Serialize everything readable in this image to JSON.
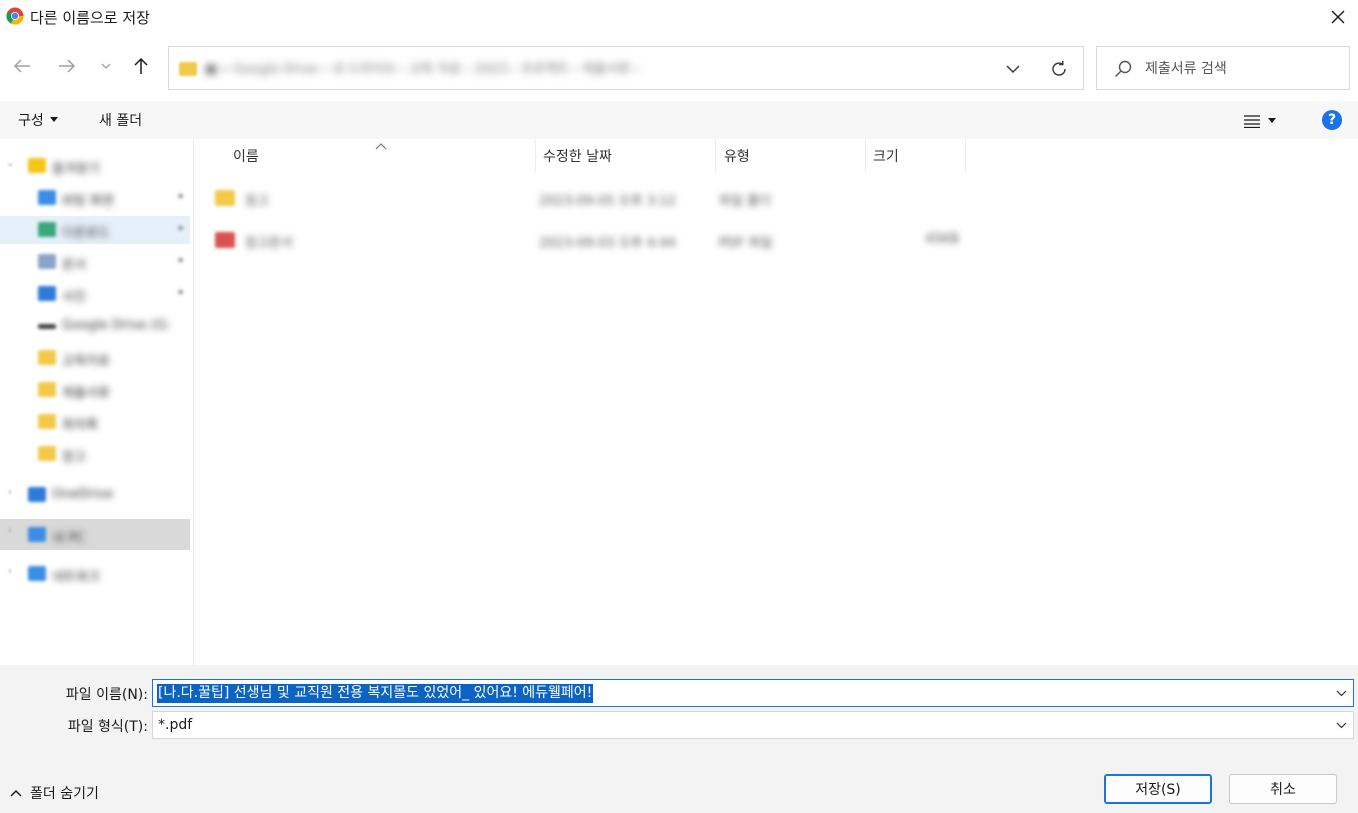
{
  "window": {
    "title": "다른 이름으로 저장"
  },
  "nav": {
    "address_path": "■ « Google Drive ›  내 드라이브 › 교육 자료 › 2023 › 프로젝트 › 제출서류 ›"
  },
  "search": {
    "placeholder": "제출서류 검색"
  },
  "toolbar": {
    "organize_label": "구성",
    "new_folder_label": "새 폴더",
    "help_label": "?"
  },
  "sidebar": {
    "items": [
      {
        "label": "즐겨찾기",
        "icon": "star-icon",
        "color": "#f5c518"
      },
      {
        "label": "바탕 화면",
        "icon": "desktop-icon",
        "color": "#3a8ee6"
      },
      {
        "label": "다운로드",
        "icon": "download-icon",
        "color": "#3aa77d"
      },
      {
        "label": "문서",
        "icon": "document-icon",
        "color": "#8aa4c8"
      },
      {
        "label": "사진",
        "icon": "pictures-icon",
        "color": "#2f7ad8"
      },
      {
        "label": "Google Drive (G:)",
        "icon": "drive-icon",
        "color": "#444444"
      },
      {
        "label": "교육자료",
        "icon": "folder-icon",
        "color": "#f3c94a"
      },
      {
        "label": "제출서류",
        "icon": "folder-icon",
        "color": "#f3c94a"
      },
      {
        "label": "회의록",
        "icon": "folder-icon",
        "color": "#f3c94a"
      },
      {
        "label": "참고",
        "icon": "folder-icon",
        "color": "#f3c94a"
      },
      {
        "label": "OneDrive",
        "icon": "cloud-icon",
        "color": "#2f7ad8"
      },
      {
        "label": "내 PC",
        "icon": "pc-icon",
        "color": "#3a8ee6"
      },
      {
        "label": "네트워크",
        "icon": "network-icon",
        "color": "#3a8ee6"
      }
    ]
  },
  "filelist": {
    "columns": [
      "이름",
      "수정한 날짜",
      "유형",
      "크기"
    ],
    "rows": [
      {
        "name": "참고",
        "date": "2023-09-05 오후 3:12",
        "type": "파일 폴더",
        "size": "",
        "icon": "folder-icon",
        "color": "#f3c94a"
      },
      {
        "name": "참고문서",
        "date": "2023-09-03 오후 4:44",
        "type": "PDF 파일",
        "size": "45KB",
        "icon": "pdf-icon",
        "color": "#d9534f"
      }
    ]
  },
  "form": {
    "filename_label": "파일 이름(N):",
    "filename_value": "[나.다.꿀팁] 선생님 및 교직원 전용 복지몰도 있었어_ 있어요! 에듀웰페어!",
    "filetype_label": "파일 형식(T):",
    "filetype_value": "*.pdf",
    "hide_folders_label": "폴더 숨기기",
    "save_label": "저장(S)",
    "cancel_label": "취소"
  },
  "colors": {
    "accent": "#1a73e8",
    "selection": "#0b63c4"
  }
}
